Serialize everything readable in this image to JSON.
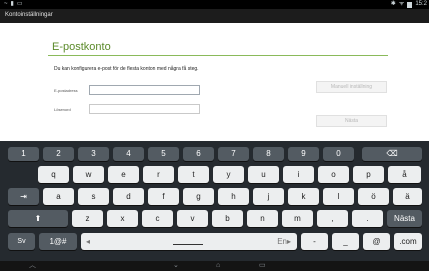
{
  "status": {
    "icons_left": [
      "~",
      "▮",
      "▭"
    ],
    "icons_right": [
      "✱",
      "ᯤ",
      "▮"
    ],
    "time": "15:2"
  },
  "title_bar": {
    "label": "Kontoinställningar"
  },
  "page": {
    "heading": "E-postkonto",
    "intro": "Du kan konfigurera e-post för de flesta konton med några få steg.",
    "email_label": "E-postadress",
    "email_value": "",
    "password_label": "Lösenord",
    "password_value": "",
    "manual_label": "Manuell inställning",
    "next_label": "Nästa"
  },
  "keyboard": {
    "row_numbers": [
      "1",
      "2",
      "3",
      "4",
      "5",
      "6",
      "7",
      "8",
      "9",
      "0"
    ],
    "row_1": [
      "q",
      "w",
      "e",
      "r",
      "t",
      "y",
      "u",
      "i",
      "o",
      "p",
      "å"
    ],
    "row_2": [
      "a",
      "s",
      "d",
      "f",
      "g",
      "h",
      "j",
      "k",
      "l",
      "ö",
      "ä"
    ],
    "row_3": [
      "z",
      "x",
      "c",
      "v",
      "b",
      "n",
      "m",
      ",",
      "."
    ],
    "tab_icon": "⇥",
    "shift_icon": "⬆",
    "backspace_icon": "⌫",
    "next_key": "Nästa",
    "lang_key": "Sv",
    "sym_key": "1@#",
    "left_arrow": "◂",
    "en_key": "En▸",
    "dash_key": "-",
    "underscore_key": "_",
    "at_key": "@",
    "com_key": ".com"
  },
  "nav": {
    "keyboard_hide": "⌄",
    "home": "⌂",
    "recents": "▭",
    "menu": "︿"
  },
  "colors": {
    "accent": "#5b8a2a",
    "keyboard_bg": "#252a2f",
    "dark_key": "#535b62",
    "light_key": "#eceeef"
  }
}
